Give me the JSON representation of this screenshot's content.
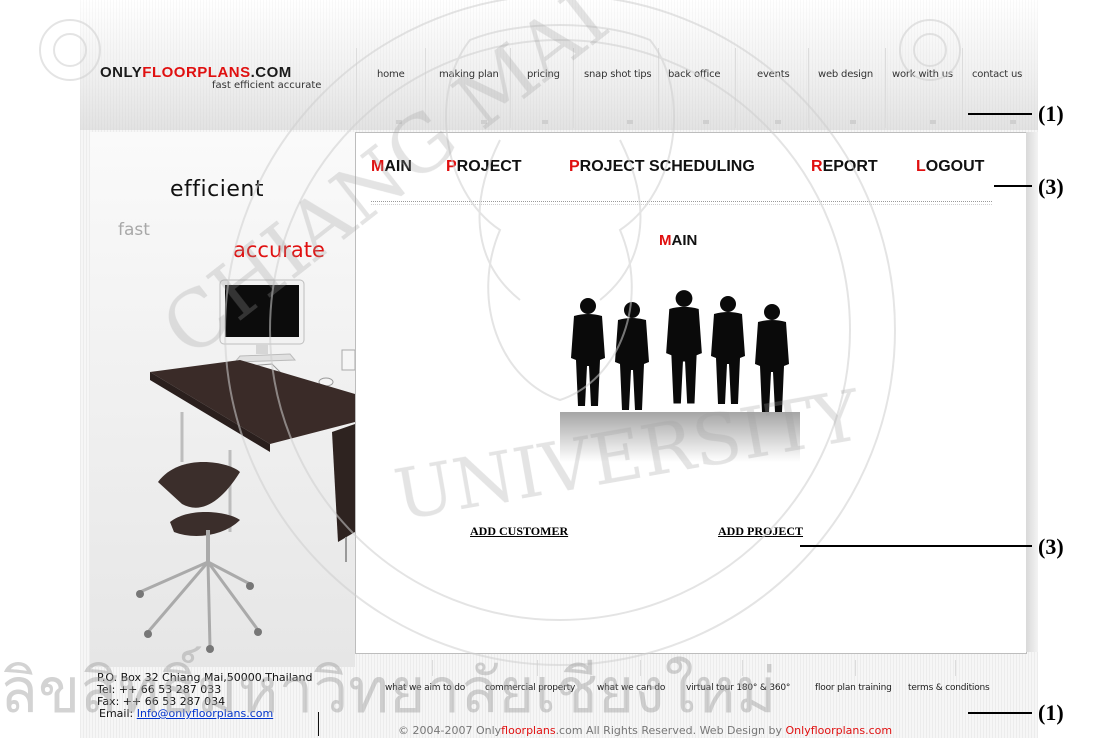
{
  "site": {
    "logo": {
      "part1": "ONLY",
      "part2": "FLOORPLANS",
      "part3": ".COM",
      "tagline": "fast efficient accurate"
    },
    "nav": [
      "home",
      "making plan",
      "pricing",
      "snap shot tips",
      "back office",
      "events",
      "web design",
      "work with us",
      "contact us"
    ]
  },
  "hero": {
    "word1": "efficient",
    "word2": "fast",
    "word3": "accurate"
  },
  "menu": [
    {
      "cap": "M",
      "rest": "AIN"
    },
    {
      "cap": "P",
      "rest": "ROJECT"
    },
    {
      "cap": "P",
      "rest": "ROJECT SCHEDULING"
    },
    {
      "cap": "R",
      "rest": "EPORT"
    },
    {
      "cap": "L",
      "rest": "OGOUT"
    }
  ],
  "main": {
    "heading_cap": "M",
    "heading_rest": "AIN",
    "add_customer": "ADD CUSTOMER",
    "add_project": "ADD PROJECT"
  },
  "footer": {
    "address": "P.O. Box 32 Chiang Mai,50000,Thailand",
    "tel": "Tel: ++ 66 53 287 033",
    "fax": "Fax: ++ 66 53 287 034",
    "email_label": "Email: ",
    "email": "Info@onlyfloorplans.com",
    "links": [
      "what we aim to do",
      "commercial property",
      "what we can do",
      "virtual tour 180° & 360°",
      "floor plan training",
      "terms & conditions"
    ],
    "copyright_pre": "© 2004-2007 Only",
    "copyright_red": "floorplans",
    "copyright_mid": ".com All Rights Reserved. Web Design by ",
    "copyright_brand1": "Only",
    "copyright_brand2": "floorplans",
    "copyright_brand3": ".com"
  },
  "annotations": [
    "(1)",
    "(3)",
    "(3)",
    "(1)"
  ]
}
